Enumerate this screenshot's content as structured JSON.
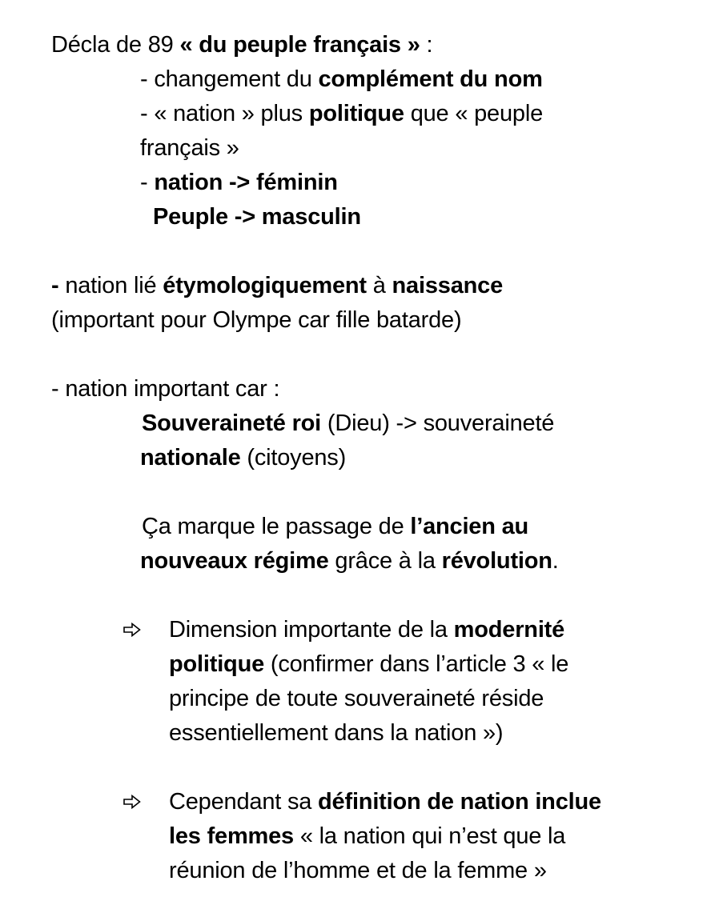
{
  "section1": {
    "title_prefix": "Décla de 89 ",
    "title_bold": "« du peuple français »",
    "title_suffix": " :",
    "item1_prefix": "- changement du ",
    "item1_bold": "complément du nom",
    "item2_prefix": "- « nation » plus ",
    "item2_bold": "politique",
    "item2_suffix": " que « peuple",
    "item2_cont": "français »",
    "item3_prefix": "- ",
    "item3_bold": "nation -> féminin",
    "item3_cont_bold": "Peuple -> masculin"
  },
  "section2": {
    "bold_dash": "-",
    "text1": " nation lié ",
    "bold1": "étymologiquement",
    "text2": " à ",
    "bold2": "naissance",
    "line2": "(important pour Olympe car fille batarde)"
  },
  "section3": {
    "intro": "- nation important car :",
    "l1_bold": "Souveraineté roi",
    "l1_text": " (Dieu) -> souveraineté",
    "l2_bold": "nationale",
    "l2_text": " (citoyens)",
    "p_text1": "Ça marque le passage de ",
    "p_bold1": "l’ancien au",
    "p_bold2": "nouveaux régime",
    "p_text2": " grâce à la ",
    "p_bold3": "révolution",
    "p_text3": "."
  },
  "bullets": [
    {
      "icon": "arrow-right-icon",
      "l1_text": "Dimension importante de la ",
      "l1_bold": "modernité",
      "l2_bold": "politique",
      "l2_text": " (confirmer dans l’article 3 « le",
      "l3_text": "principe de toute souveraineté réside",
      "l4_text": "essentiellement dans la nation »)"
    },
    {
      "icon": "arrow-right-icon",
      "l1_text": "Cependant sa ",
      "l1_bold": "définition de nation inclue",
      "l2_bold": "les femmes",
      "l2_text": " « la nation qui n’est que la",
      "l3_text": "réunion de l’homme et de la femme »"
    }
  ]
}
